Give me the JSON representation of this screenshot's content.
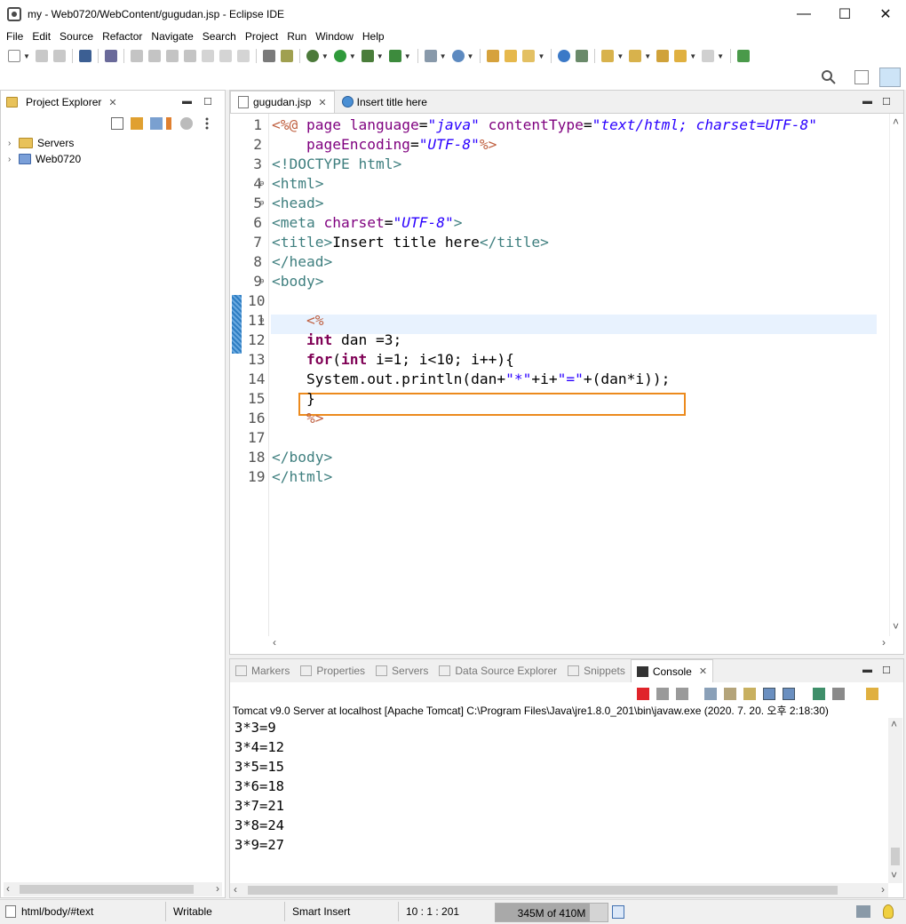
{
  "window": {
    "title": "my - Web0720/WebContent/gugudan.jsp - Eclipse IDE",
    "minimize": "—",
    "maximize": "☐",
    "close": "✕"
  },
  "menu": [
    "File",
    "Edit",
    "Source",
    "Refactor",
    "Navigate",
    "Search",
    "Project",
    "Run",
    "Window",
    "Help"
  ],
  "project_explorer": {
    "title": "Project Explorer",
    "items": [
      {
        "label": "Servers",
        "icon": "folder-icon"
      },
      {
        "label": "Web0720",
        "icon": "project-icon"
      }
    ]
  },
  "editor": {
    "tabs": [
      {
        "label": "gugudan.jsp",
        "active": true
      },
      {
        "label": "Insert title here",
        "active": false
      }
    ],
    "lines": [
      {
        "n": "1",
        "fold": false,
        "parts": [
          [
            "c-jsp",
            "<%@ "
          ],
          [
            "c-attr",
            "page "
          ],
          [
            "c-attr",
            "language"
          ],
          [
            "c-txt",
            "="
          ],
          [
            "c-str",
            "\"java\""
          ],
          [
            "c-txt",
            " "
          ],
          [
            "c-attr",
            "contentType"
          ],
          [
            "c-txt",
            "="
          ],
          [
            "c-str",
            "\"text/html; charset=UTF-8\""
          ]
        ]
      },
      {
        "n": "2",
        "fold": false,
        "parts": [
          [
            "c-txt",
            "    "
          ],
          [
            "c-attr",
            "pageEncoding"
          ],
          [
            "c-txt",
            "="
          ],
          [
            "c-str",
            "\"UTF-8\""
          ],
          [
            "c-jsp",
            "%>"
          ]
        ]
      },
      {
        "n": "3",
        "fold": false,
        "parts": [
          [
            "c-punc",
            "<!DOCTYPE "
          ],
          [
            "c-tag",
            "html"
          ],
          [
            "c-punc",
            ">"
          ]
        ]
      },
      {
        "n": "4",
        "fold": true,
        "parts": [
          [
            "c-punc",
            "<"
          ],
          [
            "c-tag",
            "html"
          ],
          [
            "c-punc",
            ">"
          ]
        ]
      },
      {
        "n": "5",
        "fold": true,
        "parts": [
          [
            "c-punc",
            "<"
          ],
          [
            "c-tag",
            "head"
          ],
          [
            "c-punc",
            ">"
          ]
        ]
      },
      {
        "n": "6",
        "fold": false,
        "parts": [
          [
            "c-punc",
            "<"
          ],
          [
            "c-tag",
            "meta "
          ],
          [
            "c-attr",
            "charset"
          ],
          [
            "c-txt",
            "="
          ],
          [
            "c-str",
            "\"UTF-8\""
          ],
          [
            "c-punc",
            ">"
          ]
        ]
      },
      {
        "n": "7",
        "fold": false,
        "parts": [
          [
            "c-punc",
            "<"
          ],
          [
            "c-tag",
            "title"
          ],
          [
            "c-punc",
            ">"
          ],
          [
            "c-txt",
            "Insert title here"
          ],
          [
            "c-punc",
            "</"
          ],
          [
            "c-tag",
            "title"
          ],
          [
            "c-punc",
            ">"
          ]
        ]
      },
      {
        "n": "8",
        "fold": false,
        "parts": [
          [
            "c-punc",
            "</"
          ],
          [
            "c-tag",
            "head"
          ],
          [
            "c-punc",
            ">"
          ]
        ]
      },
      {
        "n": "9",
        "fold": true,
        "parts": [
          [
            "c-punc",
            "<"
          ],
          [
            "c-tag",
            "body"
          ],
          [
            "c-punc",
            ">"
          ]
        ]
      },
      {
        "n": "10",
        "fold": false,
        "parts": []
      },
      {
        "n": "11",
        "fold": true,
        "parts": [
          [
            "c-txt",
            "    "
          ],
          [
            "c-jsp",
            "<%"
          ]
        ]
      },
      {
        "n": "12",
        "fold": false,
        "parts": [
          [
            "c-txt",
            "    "
          ],
          [
            "c-kw",
            "int"
          ],
          [
            "c-txt",
            " dan =3;"
          ]
        ]
      },
      {
        "n": "13",
        "fold": false,
        "parts": [
          [
            "c-txt",
            "    "
          ],
          [
            "c-kw",
            "for"
          ],
          [
            "c-txt",
            "("
          ],
          [
            "c-kw",
            "int"
          ],
          [
            "c-txt",
            " i=1; i<10; i++){"
          ]
        ]
      },
      {
        "n": "14",
        "fold": false,
        "parts": [
          [
            "c-txt",
            "    System.out.println(dan+"
          ],
          [
            "c-jstr",
            "\"*\""
          ],
          [
            "c-txt",
            "+i+"
          ],
          [
            "c-jstr",
            "\"=\""
          ],
          [
            "c-txt",
            "+(dan*i));"
          ]
        ]
      },
      {
        "n": "15",
        "fold": false,
        "parts": [
          [
            "c-txt",
            "    }"
          ]
        ]
      },
      {
        "n": "16",
        "fold": false,
        "parts": [
          [
            "c-txt",
            "    "
          ],
          [
            "c-jsp",
            "%>"
          ]
        ]
      },
      {
        "n": "17",
        "fold": false,
        "parts": []
      },
      {
        "n": "18",
        "fold": false,
        "parts": [
          [
            "c-punc",
            "</"
          ],
          [
            "c-tag",
            "body"
          ],
          [
            "c-punc",
            ">"
          ]
        ]
      },
      {
        "n": "19",
        "fold": false,
        "parts": [
          [
            "c-punc",
            "</"
          ],
          [
            "c-tag",
            "html"
          ],
          [
            "c-punc",
            ">"
          ]
        ]
      }
    ]
  },
  "console": {
    "tabs": [
      {
        "label": "Markers",
        "active": false
      },
      {
        "label": "Properties",
        "active": false
      },
      {
        "label": "Servers",
        "active": false
      },
      {
        "label": "Data Source Explorer",
        "active": false
      },
      {
        "label": "Snippets",
        "active": false
      },
      {
        "label": "Console",
        "active": true
      }
    ],
    "description": "Tomcat v9.0 Server at localhost [Apache Tomcat] C:\\Program Files\\Java\\jre1.8.0_201\\bin\\javaw.exe (2020. 7. 20. 오후 2:18:30)",
    "output": [
      "3*3=9",
      "3*4=12",
      "3*5=15",
      "3*6=18",
      "3*7=21",
      "3*8=24",
      "3*9=27"
    ]
  },
  "status": {
    "path": "html/body/#text",
    "writable": "Writable",
    "insert_mode": "Smart Insert",
    "position": "10 : 1 : 201",
    "heap": "345M of 410M",
    "heap_fraction": 0.84
  },
  "colors": {
    "accent_highlight": "#ec8a1d",
    "current_line": "#e8f2fe"
  }
}
